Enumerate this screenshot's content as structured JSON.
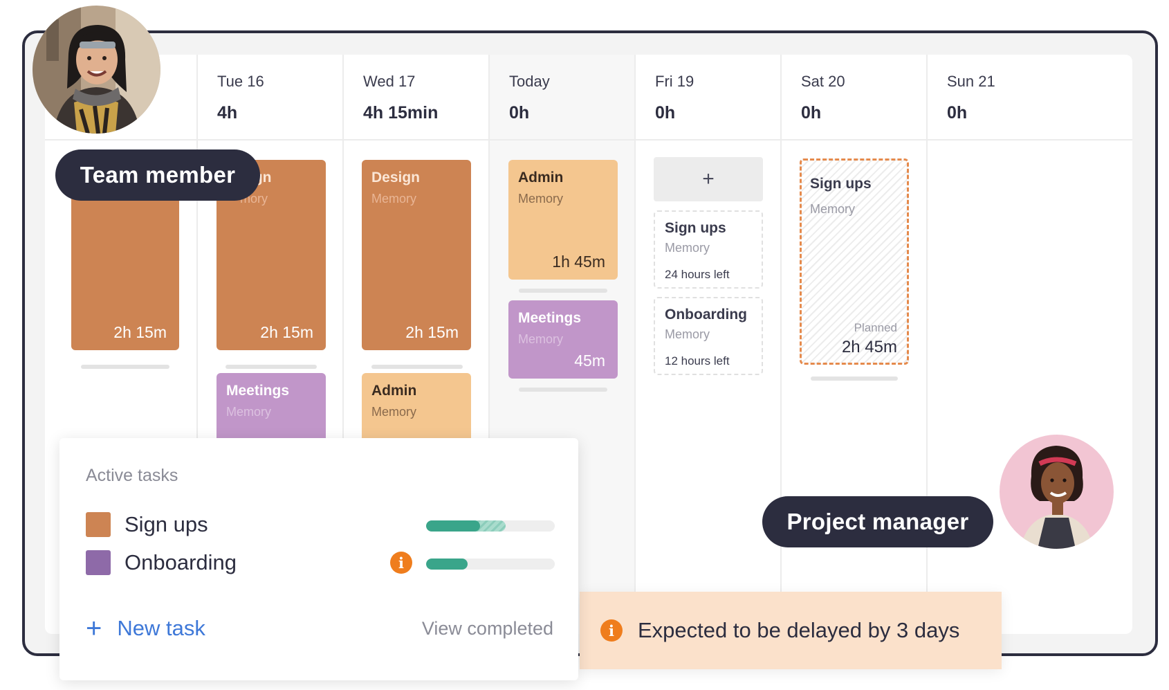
{
  "days": [
    {
      "label": "",
      "hours": ""
    },
    {
      "label": "Tue 16",
      "hours": "4h"
    },
    {
      "label": "Wed 17",
      "hours": "4h 15min"
    },
    {
      "label": "Today",
      "hours": "0h"
    },
    {
      "label": "Fri 19",
      "hours": "0h"
    },
    {
      "label": "Sat 20",
      "hours": "0h"
    },
    {
      "label": "Sun 21",
      "hours": "0h"
    }
  ],
  "cards": {
    "mon_design": {
      "duration": "2h 15m"
    },
    "tue_design": {
      "title": "ign",
      "subtitle": "mory",
      "duration": "2h 15m"
    },
    "tue_meetings": {
      "title": "Meetings",
      "subtitle": "Memory"
    },
    "wed_design": {
      "title": "Design",
      "subtitle": "Memory",
      "duration": "2h 15m"
    },
    "wed_admin": {
      "title": "Admin",
      "subtitle": "Memory"
    },
    "today_admin": {
      "title": "Admin",
      "subtitle": "Memory",
      "duration": "1h 45m"
    },
    "today_meetings": {
      "title": "Meetings",
      "subtitle": "Memory",
      "duration": "45m"
    },
    "fri_add": "+",
    "fri_signups": {
      "title": "Sign ups",
      "subtitle": "Memory",
      "left": "24 hours left"
    },
    "fri_onboarding": {
      "title": "Onboarding",
      "subtitle": "Memory",
      "left": "12 hours left"
    },
    "sat_signups": {
      "title": "Sign ups",
      "subtitle": "Memory",
      "planned_label": "Planned",
      "duration": "2h 45m"
    }
  },
  "labels": {
    "team_member": "Team member",
    "project_manager": "Project manager"
  },
  "active_tasks": {
    "title": "Active tasks",
    "tasks": [
      {
        "name": "Sign ups",
        "color": "#cd8453",
        "progress_done": 0.42,
        "progress_planned": 0.62
      },
      {
        "name": "Onboarding",
        "color": "#8e6aa8",
        "progress_done": 0.32,
        "warning_icon": "info-icon"
      }
    ],
    "new_task": "New task",
    "view_completed": "View completed"
  },
  "delay_banner": {
    "icon": "info-icon",
    "text": "Expected to be delayed by 3 days"
  },
  "colors": {
    "dark": "#2c2d3f",
    "task_orange": "#cd8453",
    "task_yellow": "#f4c68f",
    "task_purple": "#c196c9",
    "progress_green": "#3aa58a",
    "link_blue": "#3e78d8",
    "warning_orange": "#ef7d1d",
    "banner_bg": "#fbe1cb"
  }
}
